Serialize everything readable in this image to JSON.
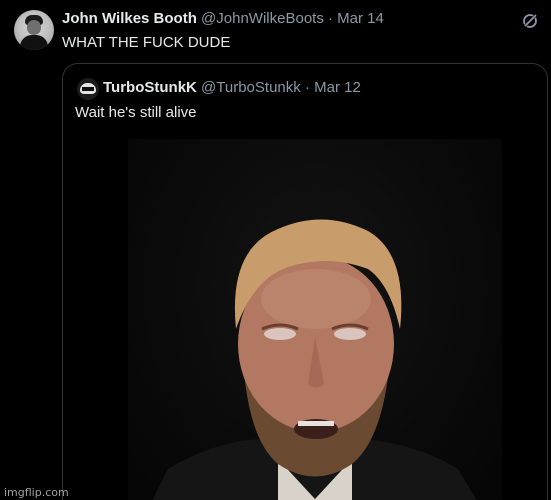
{
  "tweet": {
    "author_name": "John Wilkes Booth",
    "handle": "@JohnWilkeBoots",
    "separator": "·",
    "date": "Mar 14",
    "text": "WHAT THE FUCK DUDE"
  },
  "quoted_tweet": {
    "author_name": "TurboStunkK",
    "handle": "@TurboStunkk",
    "separator": "·",
    "date": "Mar 12",
    "text": "Wait he's still alive"
  },
  "icons": {
    "grok": "grok-icon"
  },
  "watermark": "imgflip.com",
  "colors": {
    "background": "#000000",
    "text_primary": "#e7e9ea",
    "text_secondary": "#8b98a5",
    "border": "#2f3336"
  }
}
